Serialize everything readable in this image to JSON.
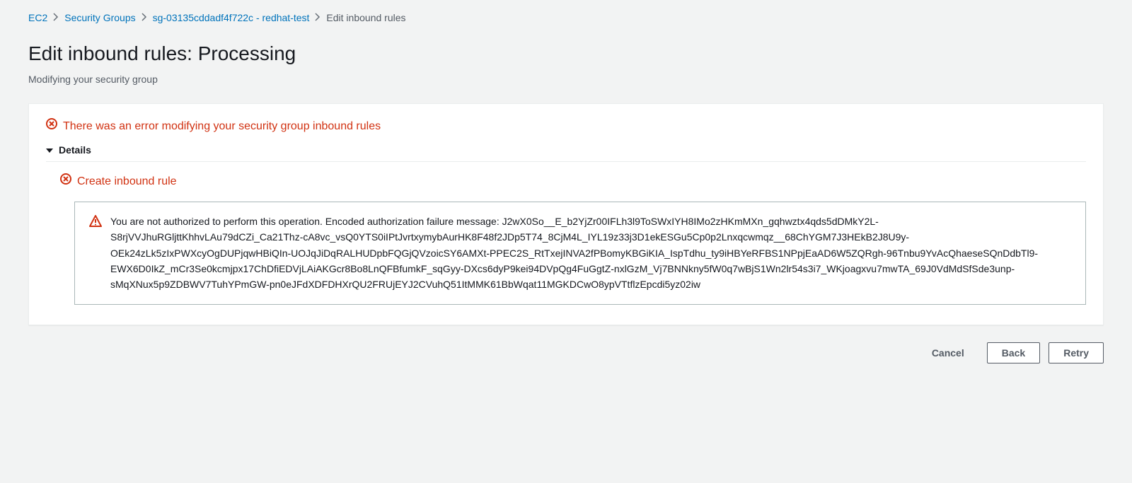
{
  "breadcrumbs": {
    "items": [
      {
        "label": "EC2"
      },
      {
        "label": "Security Groups"
      },
      {
        "label": "sg-03135cddadf4f722c - redhat-test"
      }
    ],
    "current": "Edit inbound rules"
  },
  "header": {
    "title": "Edit inbound rules: Processing",
    "subtitle": "Modifying your security group"
  },
  "alert": {
    "title": "There was an error modifying your security group inbound rules",
    "details_label": "Details",
    "sub_title": "Create inbound rule",
    "message": "You are not authorized to perform this operation. Encoded authorization failure message: J2wX0So__E_b2YjZr00IFLh3l9ToSWxIYH8IMo2zHKmMXn_gqhwztx4qds5dDMkY2L-S8rjVVJhuRGljttKhhvLAu79dCZi_Ca21Thz-cA8vc_vsQ0YTS0iIPtJvrtxymybAurHK8F48f2JDp5T74_8CjM4L_IYL19z33j3D1ekESGu5Cp0p2Lnxqcwmqz__68ChYGM7J3HEkB2J8U9y-OEk24zLk5zIxPWXcyOgDUPjqwHBiQIn-UOJqJiDqRALHUDpbFQGjQVzoicSY6AMXt-PPEC2S_RtTxejINVA2fPBomyKBGiKIA_IspTdhu_ty9iHBYeRFBS1NPpjEaAD6W5ZQRgh-96Tnbu9YvAcQhaeseSQnDdbTl9-EWX6D0IkZ_mCr3Se0kcmjpx17ChDfiEDVjLAiAKGcr8Bo8LnQFBfumkF_sqGyy-DXcs6dyP9kei94DVpQg4FuGgtZ-nxlGzM_Vj7BNNkny5fW0q7wBjS1Wn2lr54s3i7_WKjoagxvu7mwTA_69J0VdMdSfSde3unp-sMqXNux5p9ZDBWV7TuhYPmGW-pn0eJFdXDFDHXrQU2FRUjEYJ2CVuhQ51ItMMK61BbWqat11MGKDCwO8ypVTtflzEpcdi5yz02iw"
  },
  "actions": {
    "cancel": "Cancel",
    "back": "Back",
    "retry": "Retry"
  }
}
